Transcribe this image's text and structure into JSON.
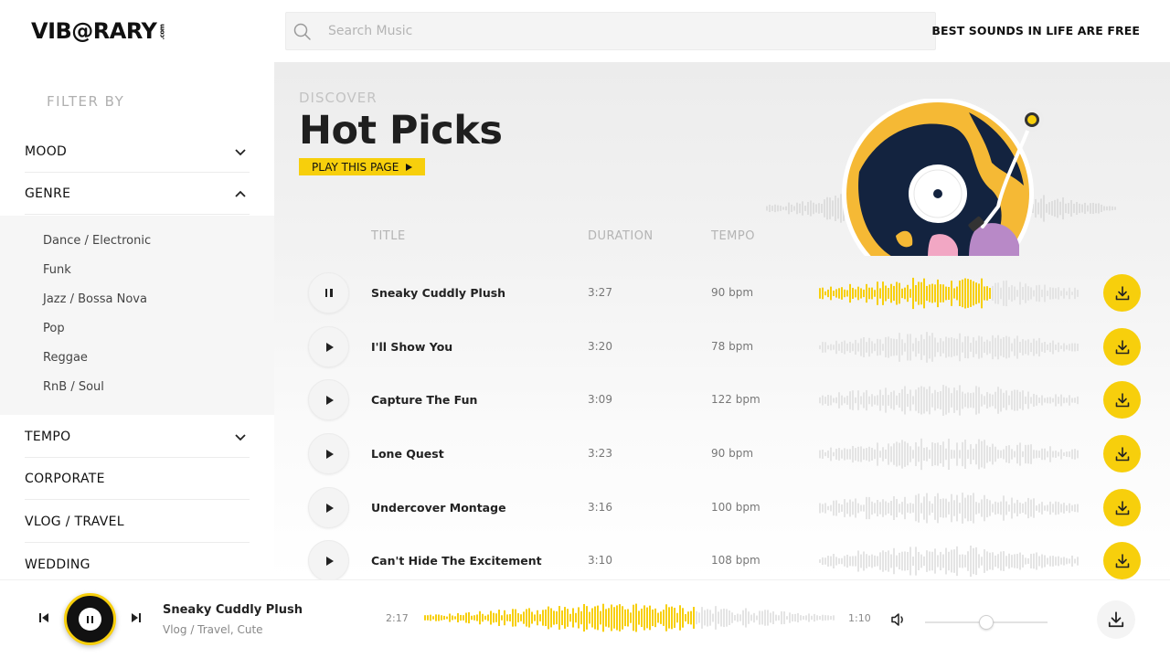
{
  "header": {
    "logo": "VIB@RARY",
    "logo_suffix": ".com",
    "search_placeholder": "Search Music",
    "tagline": "BEST SOUNDS IN LIFE ARE FREE"
  },
  "sidebar": {
    "filter_label": "FILTER BY",
    "categories_top": [
      {
        "label": "MOOD",
        "state": "collapsed"
      },
      {
        "label": "GENRE",
        "state": "expanded"
      }
    ],
    "genres": [
      "Dance / Electronic",
      "Funk",
      "Jazz / Bossa Nova",
      "Pop",
      "Reggae",
      "RnB / Soul"
    ],
    "categories_bottom": [
      {
        "label": "TEMPO",
        "state": "collapsed"
      },
      {
        "label": "CORPORATE",
        "state": "none"
      },
      {
        "label": "VLOG / TRAVEL",
        "state": "none"
      },
      {
        "label": "WEDDING",
        "state": "none"
      }
    ]
  },
  "main": {
    "eyebrow": "DISCOVER",
    "title": "Hot Picks",
    "play_page_label": "PLAY THIS PAGE",
    "columns": {
      "title": "TITLE",
      "duration": "DURATION",
      "tempo": "TEMPO"
    },
    "tracks": [
      {
        "title": "Sneaky Cuddly Plush",
        "duration": "3:27",
        "tempo": "90 bpm",
        "state": "playing",
        "progress": 0.66
      },
      {
        "title": "I'll Show You",
        "duration": "3:20",
        "tempo": "78 bpm",
        "state": "stopped",
        "progress": 0
      },
      {
        "title": "Capture The Fun",
        "duration": "3:09",
        "tempo": "122 bpm",
        "state": "stopped",
        "progress": 0
      },
      {
        "title": "Lone Quest",
        "duration": "3:23",
        "tempo": "90 bpm",
        "state": "stopped",
        "progress": 0
      },
      {
        "title": "Undercover Montage",
        "duration": "3:16",
        "tempo": "100 bpm",
        "state": "stopped",
        "progress": 0
      },
      {
        "title": "Can't Hide The Excitement",
        "duration": "3:10",
        "tempo": "108 bpm",
        "state": "stopped",
        "progress": 0
      }
    ]
  },
  "player": {
    "title": "Sneaky Cuddly Plush",
    "tags": "Vlog / Travel, Cute",
    "elapsed": "2:17",
    "remaining": "1:10",
    "progress": 0.66,
    "volume": 0.5
  },
  "colors": {
    "accent": "#f7cf0c",
    "waveform_inactive": "#e4e4e4",
    "text_dark": "#1f1f1f",
    "text_muted": "#b4b4b4"
  },
  "icons": {
    "search": "search-icon",
    "chevron_down": "chevron-down-icon",
    "chevron_up": "chevron-up-icon",
    "play": "play-icon",
    "pause": "pause-icon",
    "download": "download-icon",
    "prev": "skip-previous-icon",
    "next": "skip-next-icon",
    "volume": "volume-icon"
  }
}
